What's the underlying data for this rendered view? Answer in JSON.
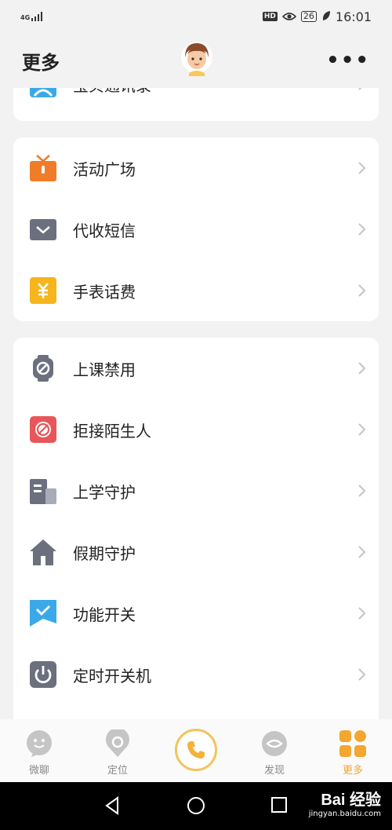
{
  "status_bar": {
    "network": "4G",
    "battery": "26",
    "time": "16:01",
    "hd": "HD"
  },
  "header": {
    "title": "更多",
    "more": "•••"
  },
  "sections": [
    {
      "items": [
        {
          "label": "宝贝通讯录",
          "icon": "contacts-icon"
        }
      ]
    },
    {
      "items": [
        {
          "label": "活动广场",
          "icon": "gift-icon"
        },
        {
          "label": "代收短信",
          "icon": "envelope-icon"
        },
        {
          "label": "手表话费",
          "icon": "yuan-icon"
        }
      ]
    },
    {
      "items": [
        {
          "label": "上课禁用",
          "icon": "watch-ban-icon"
        },
        {
          "label": "拒接陌生人",
          "icon": "block-call-icon"
        },
        {
          "label": "上学守护",
          "icon": "school-icon"
        },
        {
          "label": "假期守护",
          "icon": "home-icon"
        },
        {
          "label": "功能开关",
          "icon": "check-flag-icon"
        },
        {
          "label": "定时开关机",
          "icon": "power-icon"
        }
      ]
    }
  ],
  "bottom_nav": [
    {
      "label": "微聊",
      "icon": "chat-icon",
      "active": false
    },
    {
      "label": "定位",
      "icon": "location-icon",
      "active": false
    },
    {
      "label": "",
      "icon": "phone-icon",
      "active": false
    },
    {
      "label": "发现",
      "icon": "discover-icon",
      "active": false
    },
    {
      "label": "更多",
      "icon": "more-grid-icon",
      "active": true
    }
  ],
  "watermark": {
    "brand": "Bai 经验",
    "url": "jingyan.baidu.com"
  },
  "colors": {
    "accent": "#f3a630",
    "icon_gray": "#6b6f7e",
    "orange": "#f07c2a",
    "yellow": "#f6b51c",
    "red": "#e8565a",
    "blue": "#3ba9e9"
  }
}
